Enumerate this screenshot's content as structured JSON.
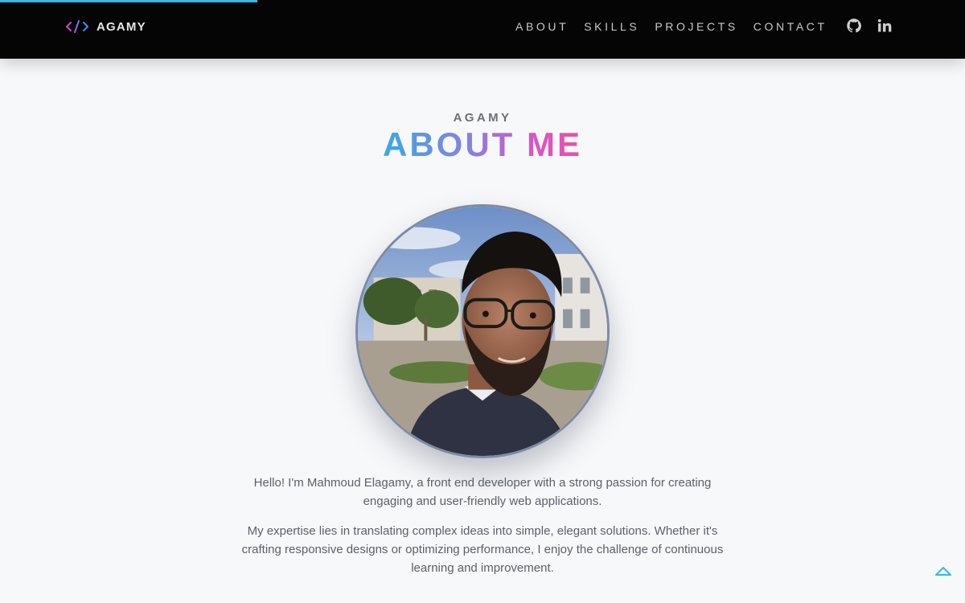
{
  "header": {
    "brand": "AGAMY",
    "nav": [
      "ABOUT",
      "SKILLS",
      "PROJECTS",
      "CONTACT"
    ],
    "social": [
      "github-icon",
      "linkedin-icon"
    ]
  },
  "about": {
    "eyebrow": "AGAMY",
    "title": "ABOUT ME",
    "paragraphs": [
      "Hello! I'm Mahmoud Elagamy, a front end developer with a strong passion for creating engaging and user-friendly web applications.",
      "My expertise lies in translating complex ideas into simple, elegant solutions. Whether it's crafting responsive designs or optimizing performance, I enjoy the challenge of continuous learning and improvement."
    ]
  },
  "colors": {
    "accent_blue": "#38b6e8",
    "accent_pink": "#f04ea5",
    "navbar_bg": "#050505",
    "page_bg": "#f7f8fa"
  }
}
